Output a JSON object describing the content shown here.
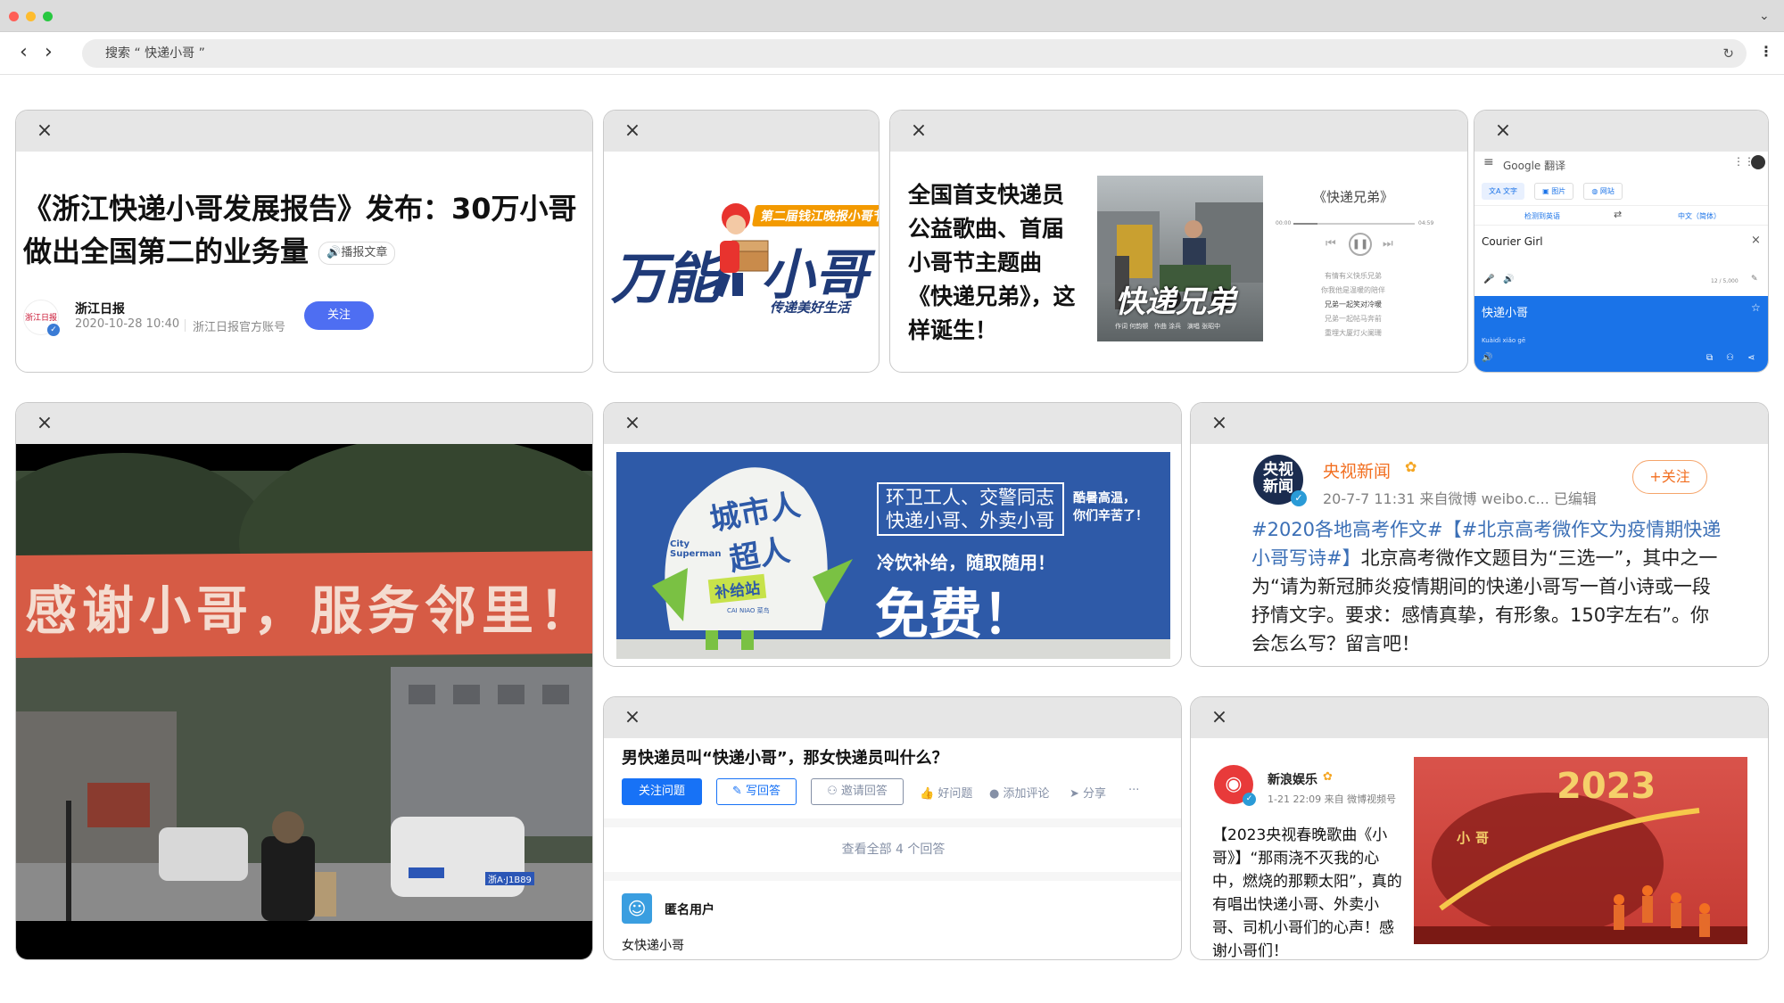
{
  "browser": {
    "search_text": "搜索 “ 快递小哥 ”",
    "window_dots": [
      "#ff5f57",
      "#febc2e",
      "#28c840"
    ]
  },
  "cards": {
    "zjrb": {
      "headline": "《浙江快递小哥发展报告》发布：30万小哥做出全国第二的业务量",
      "listen_label": "播报文章",
      "logo_text": "浙江日报",
      "publisher": "浙江日报",
      "datetime": "2020-10-28 10:40",
      "account": "浙江日报官方账号",
      "follow_label": "关注"
    },
    "wanneng": {
      "big_text_1": "万能",
      "big_text_2": "小哥",
      "banner_text": "第二届钱江晚报小哥节",
      "slogan": "传递美好生活"
    },
    "song": {
      "text": "全国首支快递员公益歌曲、首届小哥节主题曲《快递兄弟》，这样诞生！",
      "cover_title": "快递兄弟",
      "cover_credits": [
        "作词 何韵顿",
        "作曲 涂兵",
        "演唱 张昭中"
      ],
      "player_title": "《快递兄弟》",
      "time_start": "00:00",
      "time_end": "04:59",
      "lyrics": [
        "有情有义快乐兄弟",
        "你我他是温暖的陪伴",
        "兄弟一起笑对冷暖",
        "兄弟一起帖马奔前",
        "重埋大厦灯火阑珊"
      ]
    },
    "translate": {
      "app_name": "Google 翻译",
      "tabs": [
        "文字",
        "图片",
        "网站"
      ],
      "source_lang": "检测到英语",
      "target_lang": "中文（简体）",
      "source_text": "Courier Girl",
      "char_count": "12 / 5,000",
      "result_text": "快递小哥",
      "romanization": "Kuàidì xiǎo gē"
    },
    "photo": {
      "banner_text": "感谢小哥，服务邻里！",
      "plate": "浙A·J1B89"
    },
    "supply": {
      "mascot_line1": "城市人",
      "mascot_line2": "超人",
      "mascot_en": "City Superman",
      "station": "补给站",
      "logo_small": "CAI NIAO 菜鸟",
      "box_line1": "环卫工人、交警同志",
      "box_line2": "快递小哥、外卖小哥",
      "side_line1": "酷暑高温，",
      "side_line2": "你们辛苦了！",
      "offer": "冷饮补给，随取随用！",
      "free": "免费！"
    },
    "weibo_cctv": {
      "avatar_text": "央视新闻",
      "name": "央视新闻",
      "meta": "20-7-7 11:31  来自微博 weibo.c...  已编辑",
      "follow_label": "+关注",
      "hashtag_text": "#2020各地高考作文#【#北京高考微作文为疫情期快递小哥写诗#】",
      "body_text": "北京高考微作文题目为“三选一”，其中之一为“请为新冠肺炎疫情期间的快递小哥写一首小诗或一段抒情文字。要求：感情真挚，有形象。150字左右”。你会怎么写？留言吧！"
    },
    "zhihu": {
      "question": "男快递员叫“快递小哥”，那女快递员叫什么？",
      "buttons": [
        "关注问题",
        "写回答",
        "邀请回答"
      ],
      "actions": [
        "好问题",
        "添加评论",
        "分享",
        "···"
      ],
      "view_all": "查看全部 4 个回答",
      "user": "匿名用户",
      "answer": "女快递小哥"
    },
    "weibo_sina": {
      "name": "新浪娱乐",
      "meta": "1-21 22:09  来自 微博视频号",
      "body_text": "【2023央视春晚歌曲《小哥》】“那雨浇不灭我的心中，燃烧的那颗太阳”，真的有唱出快递小哥、外卖小哥、司机小哥们的心声！感谢小哥们！",
      "video_title": "小哥",
      "video_year": "2023"
    }
  }
}
